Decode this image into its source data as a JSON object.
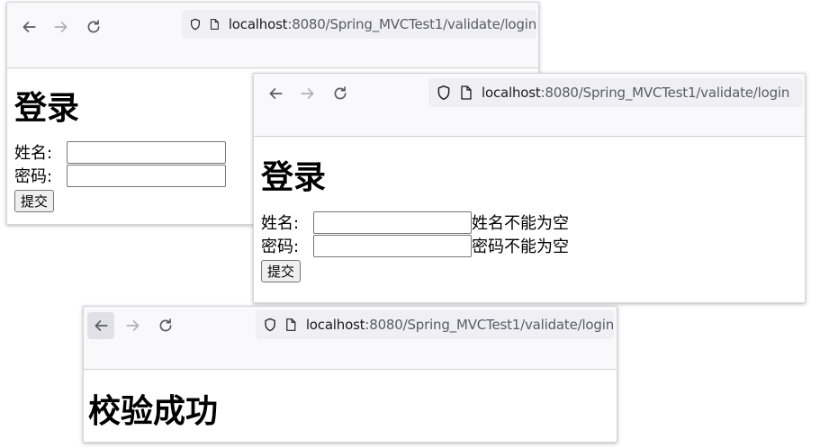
{
  "windows": [
    {
      "url_host": "localhost",
      "url_path": ":8080/Spring_MVCTest1/validate/login",
      "heading": "登录",
      "name_label": "姓名:",
      "password_label": "密码:",
      "submit_label": "提交"
    },
    {
      "url_host": "localhost",
      "url_path": ":8080/Spring_MVCTest1/validate/login",
      "heading": "登录",
      "name_label": "姓名:",
      "password_label": "密码:",
      "name_error": "姓名不能为空",
      "password_error": "密码不能为空",
      "submit_label": "提交"
    },
    {
      "url_host": "localhost",
      "url_path": ":8080/Spring_MVCTest1/validate/login",
      "heading": "校验成功"
    }
  ],
  "icons": {
    "back": "back-arrow-icon",
    "forward": "forward-arrow-icon",
    "reload": "reload-icon",
    "shield": "tracking-protection-shield-icon",
    "page": "page-info-icon"
  },
  "colors": {
    "chrome_bg": "#f9f9fb",
    "urlbar_bg": "#f0f0f4",
    "forward_disabled": "#b0b0b8"
  }
}
